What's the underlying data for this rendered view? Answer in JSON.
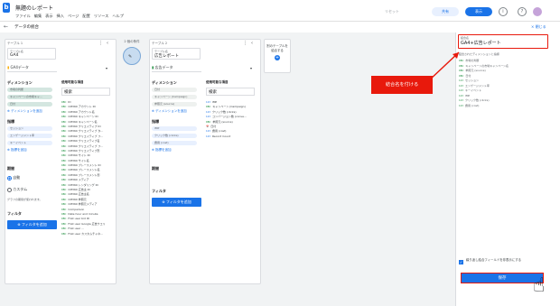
{
  "app": {
    "title": "無題のレポート",
    "menu": [
      "ファイル",
      "編集",
      "表示",
      "挿入",
      "ページ",
      "配置",
      "リソース",
      "ヘルプ"
    ],
    "reset": "リセット",
    "share": "共有",
    "view": "表示",
    "info_icon": "i",
    "help_icon": "?",
    "logo": "b"
  },
  "subheader": {
    "back": "←",
    "title": "データの統合",
    "close": "× 閉じる"
  },
  "table1": {
    "header": "テーブル 1",
    "name_label": "テーブル名",
    "name": "GA4",
    "source": "GA4データ",
    "dims_title": "ディメンション",
    "dims": [
      "市場の判断",
      "キャンペーンの市場キャ...",
      "日付"
    ],
    "add_dim": "ディメンションを追加",
    "metrics_title": "指標",
    "metrics": [
      "セッション",
      "エンゲージメント率",
      "キーイベント"
    ],
    "add_metric": "指標を追加",
    "range_title": "期間",
    "auto": "自動",
    "custom": "カスタム",
    "range_note": "グラフの期間が使われます。",
    "filter_title": "フィルタ",
    "filter_btn": "フィルタを追加",
    "avail_title": "使用可能な項目",
    "search": "検索",
    "fields": [
      "ID",
      "CM360 アカウント ID",
      "CM360 アカウント名",
      "CM360 キャンペーン ID",
      "CM360 キャンペーン名",
      "CM360 クリエイティブ ID",
      "CM360 クリエイティブ タ...",
      "CM360 クリエイティブ フ...",
      "CM360 クリエイティブ名",
      "CM360 クリエイティブ フ...",
      "CM360 クリエイティブ形",
      "CM360 サイト ID",
      "CM360 サイト名",
      "CM360 プレースメント ID",
      "CM360 プレースメント名",
      "CM360 プレースメント形",
      "CM360 メディア",
      "CM360 レンダリング ID",
      "CM360 広告主 ID",
      "CM360 広告主名",
      "CM360 参照元",
      "CM360 参照元メディア",
      "Comparison",
      "Date hour and minute",
      "First user bid ID",
      "First user Google 広告クエリ",
      "First user ...",
      "First user カスタムチャネ..."
    ]
  },
  "join": {
    "label": "2 個の条件"
  },
  "table2": {
    "header": "テーブル 2",
    "name_label": "テーブル名",
    "name": "広告レポート",
    "source": "広告データ",
    "dims_title": "ディメンション",
    "dims": [
      "日付",
      "キャンペーン (Campaign)",
      "参照元 (source)"
    ],
    "add_dim": "ディメンションを追加",
    "metrics_title": "指標",
    "metrics": [
      "IMP",
      "クリック数 (clicks)",
      "費用 (cost)"
    ],
    "add_metric": "指標を追加",
    "range_title": "期間",
    "auto": "自動",
    "custom": "カスタム",
    "range_note": "グラフの期間が使われます。",
    "filter_title": "フィルタ",
    "filter_btn": "フィルタを追加",
    "avail_title": "使用可能な項目",
    "search": "検索",
    "fields": [
      "IMP",
      "キャンペーン (Campaign)",
      "クリック数 (clicks)",
      "コンバージョン数 (conve...",
      "参照元 (source)",
      "日付",
      "費用 (cost)",
      "Record Count"
    ]
  },
  "add_table": {
    "label": "別のテーブルを結合する",
    "icon": "+"
  },
  "right": {
    "name_label": "結合名",
    "name": "GA4+広告レポート",
    "table_header": "結合されたディメンションと指標",
    "items": [
      "市場の判断",
      "キャンペーンの市場キャンペーン名",
      "参照元 (source)",
      "日付",
      "セッション",
      "エンゲージメント率",
      "キーイベント",
      "IMP",
      "クリック数 (clicks)",
      "費用 (cost)"
    ],
    "checkbox_label": "繰り返し結合フィールドを非表示にする",
    "save": "保存"
  },
  "annotation": {
    "callout": "結合名を付ける"
  },
  "colors": {
    "accent": "#1a73e8",
    "annotation": "#e8190c",
    "chip": "#d4e6e0"
  }
}
